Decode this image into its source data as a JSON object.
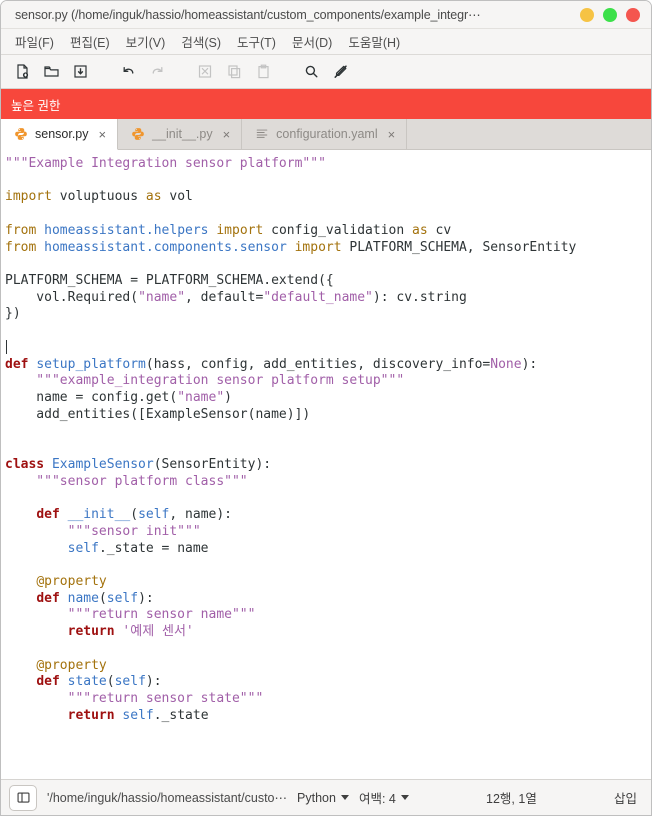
{
  "window": {
    "title": "sensor.py (/home/inguk/hassio/homeassistant/custom_components/example_integr⋯",
    "buttons": [
      {
        "name": "minimize",
        "color": "#f6c344"
      },
      {
        "name": "maximize",
        "color": "#3ce04a"
      },
      {
        "name": "close",
        "color": "#f4564f"
      }
    ]
  },
  "menubar": {
    "items": [
      {
        "label": "파일(F)",
        "name": "file"
      },
      {
        "label": "편집(E)",
        "name": "edit"
      },
      {
        "label": "보기(V)",
        "name": "view"
      },
      {
        "label": "검색(S)",
        "name": "search"
      },
      {
        "label": "도구(T)",
        "name": "tools"
      },
      {
        "label": "문서(D)",
        "name": "documents"
      },
      {
        "label": "도움말(H)",
        "name": "help"
      }
    ]
  },
  "toolbar": {
    "buttons": [
      {
        "name": "new-file-icon",
        "enabled": true
      },
      {
        "name": "open-folder-icon",
        "enabled": true
      },
      {
        "name": "save-icon",
        "enabled": true
      },
      {
        "name": "undo-icon",
        "enabled": true
      },
      {
        "name": "redo-icon",
        "enabled": false
      },
      {
        "name": "cut-icon",
        "enabled": false
      },
      {
        "name": "copy-icon",
        "enabled": false
      },
      {
        "name": "paste-icon",
        "enabled": false
      },
      {
        "name": "search-icon",
        "enabled": true
      },
      {
        "name": "highlight-off-icon",
        "enabled": true
      }
    ]
  },
  "banner": {
    "text": "높은 권한",
    "color": "#f7473c"
  },
  "tabs": [
    {
      "label": "sensor.py",
      "icon": "python-icon",
      "close": "×",
      "active": true
    },
    {
      "label": "__init__.py",
      "icon": "python-icon",
      "close": "×",
      "active": false
    },
    {
      "label": "configuration.yaml",
      "icon": "text-lines-icon",
      "close": "×",
      "active": false
    }
  ],
  "editor": {
    "language": "Python",
    "lines": [
      [
        {
          "t": "\"\"\"Example Integration sensor platform\"\"\"",
          "c": "s-str"
        }
      ],
      [],
      [
        {
          "t": "import",
          "c": "s-kw"
        },
        {
          "t": " voluptuous ",
          "c": "s-plain"
        },
        {
          "t": "as",
          "c": "s-kw"
        },
        {
          "t": " vol",
          "c": "s-plain"
        }
      ],
      [],
      [
        {
          "t": "from",
          "c": "s-kw"
        },
        {
          "t": " ",
          "c": "s-plain"
        },
        {
          "t": "homeassistant.helpers",
          "c": "s-fn"
        },
        {
          "t": " ",
          "c": "s-plain"
        },
        {
          "t": "import",
          "c": "s-kw"
        },
        {
          "t": " config_validation ",
          "c": "s-plain"
        },
        {
          "t": "as",
          "c": "s-kw"
        },
        {
          "t": " cv",
          "c": "s-plain"
        }
      ],
      [
        {
          "t": "from",
          "c": "s-kw"
        },
        {
          "t": " ",
          "c": "s-plain"
        },
        {
          "t": "homeassistant.components.sensor",
          "c": "s-fn"
        },
        {
          "t": " ",
          "c": "s-plain"
        },
        {
          "t": "import",
          "c": "s-kw"
        },
        {
          "t": " PLATFORM_SCHEMA, SensorEntity",
          "c": "s-plain"
        }
      ],
      [],
      [
        {
          "t": "PLATFORM_SCHEMA = PLATFORM_SCHEMA.extend({",
          "c": "s-plain"
        }
      ],
      [
        {
          "t": "    vol.Required(",
          "c": "s-plain"
        },
        {
          "t": "\"name\"",
          "c": "s-str"
        },
        {
          "t": ", default=",
          "c": "s-plain"
        },
        {
          "t": "\"default_name\"",
          "c": "s-str"
        },
        {
          "t": "): cv.string",
          "c": "s-plain"
        }
      ],
      [
        {
          "t": "})",
          "c": "s-plain"
        }
      ],
      [],
      [
        {
          "t": "",
          "c": "s-plain",
          "caret": true
        }
      ],
      [
        {
          "t": "def",
          "c": "s-def"
        },
        {
          "t": " ",
          "c": "s-plain"
        },
        {
          "t": "setup_platform",
          "c": "s-fn"
        },
        {
          "t": "(hass, config, add_entities, discovery_info=",
          "c": "s-plain"
        },
        {
          "t": "None",
          "c": "s-const"
        },
        {
          "t": "):",
          "c": "s-plain"
        }
      ],
      [
        {
          "t": "    \"\"\"example_integration sensor platform setup\"\"\"",
          "c": "s-str"
        }
      ],
      [
        {
          "t": "    name = config.get(",
          "c": "s-plain"
        },
        {
          "t": "\"name\"",
          "c": "s-str"
        },
        {
          "t": ")",
          "c": "s-plain"
        }
      ],
      [
        {
          "t": "    add_entities([ExampleSensor(name)])",
          "c": "s-plain"
        }
      ],
      [],
      [],
      [
        {
          "t": "class",
          "c": "s-def"
        },
        {
          "t": " ",
          "c": "s-plain"
        },
        {
          "t": "ExampleSensor",
          "c": "s-fn"
        },
        {
          "t": "(SensorEntity):",
          "c": "s-plain"
        }
      ],
      [
        {
          "t": "    \"\"\"sensor platform class\"\"\"",
          "c": "s-str"
        }
      ],
      [],
      [
        {
          "t": "    ",
          "c": "s-plain"
        },
        {
          "t": "def",
          "c": "s-def"
        },
        {
          "t": " ",
          "c": "s-plain"
        },
        {
          "t": "__init__",
          "c": "s-fn"
        },
        {
          "t": "(",
          "c": "s-plain"
        },
        {
          "t": "self",
          "c": "s-self"
        },
        {
          "t": ", name):",
          "c": "s-plain"
        }
      ],
      [
        {
          "t": "        \"\"\"sensor init\"\"\"",
          "c": "s-str"
        }
      ],
      [
        {
          "t": "        ",
          "c": "s-plain"
        },
        {
          "t": "self",
          "c": "s-self"
        },
        {
          "t": "._state = name",
          "c": "s-plain"
        }
      ],
      [],
      [
        {
          "t": "    ",
          "c": "s-plain"
        },
        {
          "t": "@property",
          "c": "s-dec"
        }
      ],
      [
        {
          "t": "    ",
          "c": "s-plain"
        },
        {
          "t": "def",
          "c": "s-def"
        },
        {
          "t": " ",
          "c": "s-plain"
        },
        {
          "t": "name",
          "c": "s-fn"
        },
        {
          "t": "(",
          "c": "s-plain"
        },
        {
          "t": "self",
          "c": "s-self"
        },
        {
          "t": "):",
          "c": "s-plain"
        }
      ],
      [
        {
          "t": "        \"\"\"return sensor name\"\"\"",
          "c": "s-str"
        }
      ],
      [
        {
          "t": "        ",
          "c": "s-plain"
        },
        {
          "t": "return",
          "c": "s-def"
        },
        {
          "t": " ",
          "c": "s-plain"
        },
        {
          "t": "'예제 센서'",
          "c": "s-str"
        }
      ],
      [],
      [
        {
          "t": "    ",
          "c": "s-plain"
        },
        {
          "t": "@property",
          "c": "s-dec"
        }
      ],
      [
        {
          "t": "    ",
          "c": "s-plain"
        },
        {
          "t": "def",
          "c": "s-def"
        },
        {
          "t": " ",
          "c": "s-plain"
        },
        {
          "t": "state",
          "c": "s-fn"
        },
        {
          "t": "(",
          "c": "s-plain"
        },
        {
          "t": "self",
          "c": "s-self"
        },
        {
          "t": "):",
          "c": "s-plain"
        }
      ],
      [
        {
          "t": "        \"\"\"return sensor state\"\"\"",
          "c": "s-str"
        }
      ],
      [
        {
          "t": "        ",
          "c": "s-plain"
        },
        {
          "t": "return",
          "c": "s-def"
        },
        {
          "t": " ",
          "c": "s-plain"
        },
        {
          "t": "self",
          "c": "s-self"
        },
        {
          "t": "._state",
          "c": "s-plain"
        }
      ]
    ]
  },
  "statusbar": {
    "path": "'/home/inguk/hassio/homeassistant/custo⋯",
    "language": "Python",
    "indent_label": "여백: 4",
    "position": "12행, 1열",
    "mode": "삽입"
  }
}
